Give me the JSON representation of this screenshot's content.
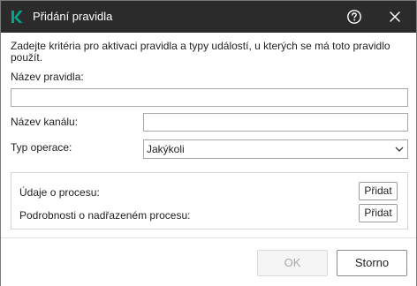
{
  "window": {
    "title": "Přidání pravidla",
    "logo_icon": "kaspersky-k-logo",
    "logo_color": "#00a88e",
    "titlebar_color": "#2b2b2b"
  },
  "form": {
    "description": "Zadejte kritéria pro aktivaci pravidla a typy událostí, u kterých se má toto pravidlo použít.",
    "rule_name_label": "Název pravidla:",
    "rule_name_value": "",
    "channel_name_label": "Název kanálu:",
    "channel_name_value": "",
    "operation_type_label": "Typ operace:",
    "operation_type_value": "Jakýkoli"
  },
  "process_group": {
    "process_data_label": "Údaje o procesu:",
    "process_data_button": "Přidat",
    "parent_process_label": "Podrobnosti o nadřazeném procesu:",
    "parent_process_button": "Přidat"
  },
  "footer": {
    "ok_label": "OK",
    "cancel_label": "Storno"
  }
}
